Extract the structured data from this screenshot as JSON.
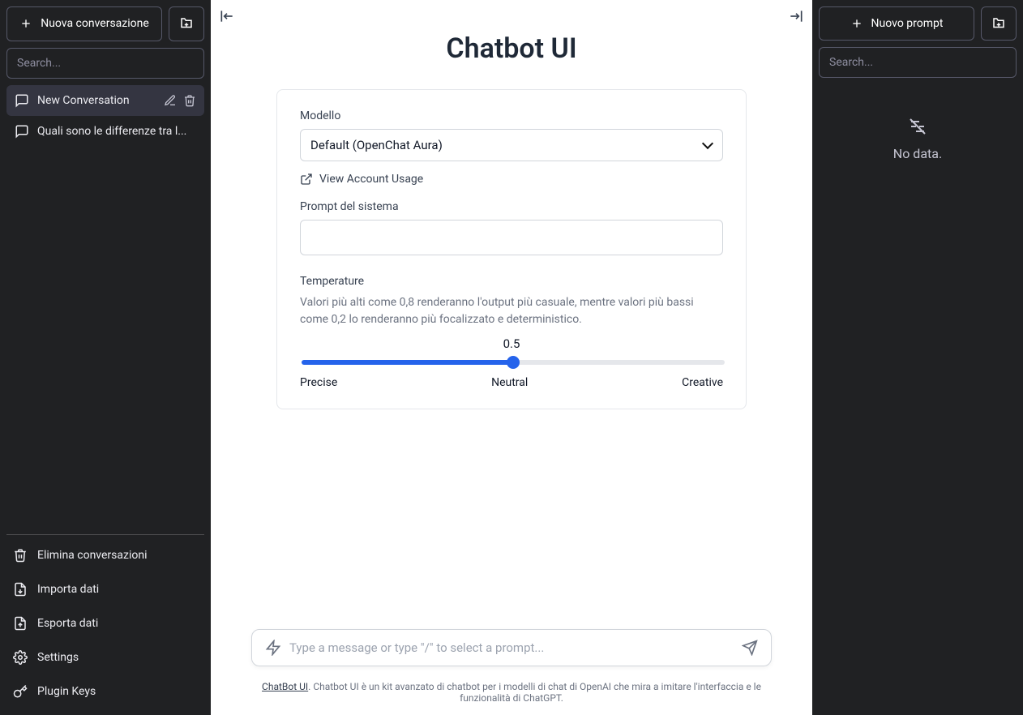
{
  "leftSidebar": {
    "newButton": "Nuova conversazione",
    "searchPlaceholder": "Search...",
    "conversations": [
      {
        "label": "New Conversation",
        "active": true
      },
      {
        "label": "Quali sono le differenze tra l...",
        "active": false
      }
    ],
    "bottomActions": [
      {
        "icon": "trash",
        "label": "Elimina conversazioni"
      },
      {
        "icon": "import",
        "label": "Importa dati"
      },
      {
        "icon": "export",
        "label": "Esporta dati"
      },
      {
        "icon": "settings",
        "label": "Settings"
      },
      {
        "icon": "key",
        "label": "Plugin Keys"
      }
    ]
  },
  "main": {
    "title": "Chatbot UI",
    "modelLabel": "Modello",
    "modelValue": "Default (OpenChat Aura)",
    "usageLink": "View Account Usage",
    "systemPromptLabel": "Prompt del sistema",
    "systemPromptValue": "",
    "temperatureLabel": "Temperature",
    "temperatureDesc": "Valori più alti come 0,8 renderanno l'output più casuale, mentre valori più bassi come 0,2 lo renderanno più focalizzato e deterministico.",
    "temperatureValue": "0.5",
    "tempLabels": {
      "low": "Precise",
      "mid": "Neutral",
      "high": "Creative"
    },
    "inputPlaceholder": "Type a message or type \"/\" to select a prompt...",
    "footerLink": "ChatBot UI",
    "footerText": ". Chatbot UI è un kit avanzato di chatbot per i modelli di chat di OpenAI che mira a imitare l'interfaccia e le funzionalità di ChatGPT."
  },
  "rightSidebar": {
    "newButton": "Nuovo prompt",
    "searchPlaceholder": "Search...",
    "emptyText": "No data."
  }
}
